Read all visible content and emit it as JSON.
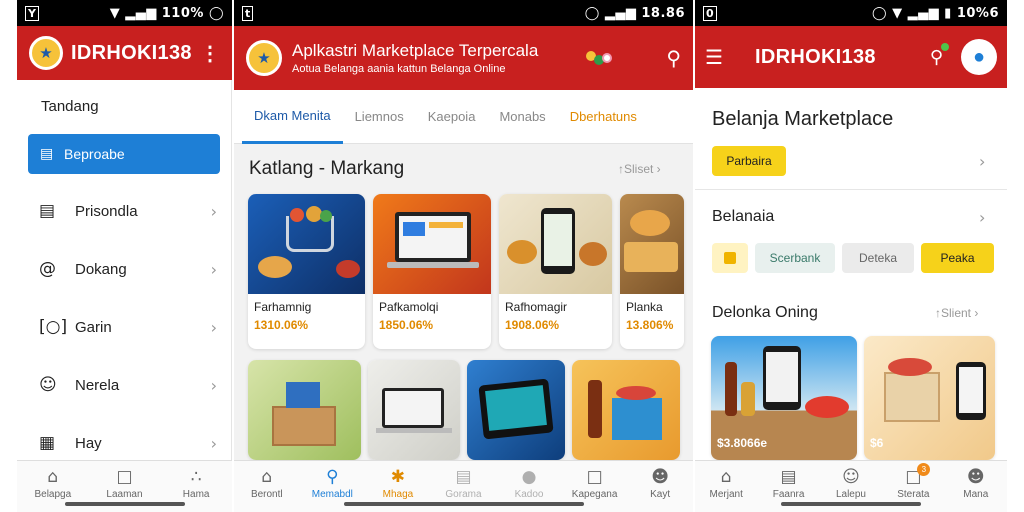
{
  "phone1": {
    "status": {
      "left": "Y",
      "right": "110%"
    },
    "brand": "IDRHOKI138",
    "menu_title": "Tandang",
    "items": [
      {
        "label": "Beproabe",
        "icon": "calendar-icon"
      },
      {
        "label": "Prisondla",
        "icon": "document-icon"
      },
      {
        "label": "Dokang",
        "icon": "at-icon"
      },
      {
        "label": "Garin",
        "icon": "scan-icon"
      },
      {
        "label": "Nerela",
        "icon": "chat-icon"
      },
      {
        "label": "Hay",
        "icon": "grid-icon"
      }
    ],
    "nav": [
      {
        "label": "Belapga",
        "icon": "home-icon"
      },
      {
        "label": "Laaman",
        "icon": "book-icon"
      },
      {
        "label": "Hama",
        "icon": "people-icon"
      }
    ]
  },
  "phone2": {
    "status": {
      "left": "t",
      "right": "18.86"
    },
    "title": "Aplkastri Marketplace Terpercala",
    "subtitle": "Aotua Belanga aania kattun Belanga Online",
    "tabs": [
      "Dkam Menita",
      "Liemnos",
      "Kaepoia",
      "Monabs",
      "Dberhatuns"
    ],
    "section_title": "Katlang - Markang",
    "more": "Sliset",
    "products": [
      {
        "name": "Farhamnig",
        "price": "1310.06%"
      },
      {
        "name": "Pafkamolqi",
        "price": "1850.06%"
      },
      {
        "name": "Rafhomagir",
        "price": "1908.06%"
      },
      {
        "name": "Planka",
        "price": "13.806%"
      }
    ],
    "nav": [
      {
        "label": "Berontl",
        "icon": "home-icon"
      },
      {
        "label": "Memabdl",
        "icon": "search-icon"
      },
      {
        "label": "Mhaga",
        "icon": "puzzle-icon"
      },
      {
        "label": "Gorama",
        "icon": "list-icon"
      },
      {
        "label": "Kadoo",
        "icon": "circle-icon"
      },
      {
        "label": "Kapegana",
        "icon": "book-icon"
      },
      {
        "label": "Kayt",
        "icon": "profile-icon"
      }
    ]
  },
  "phone3": {
    "status": {
      "left": "0",
      "right": "10%6"
    },
    "brand": "IDRHOKI138",
    "heading": "Belanja Marketplace",
    "promo_button": "Parbaira",
    "row_label": "Belanaia",
    "chips": [
      "Scerbank",
      "Deteka",
      "Peaka"
    ],
    "section_title": "Delonka Oning",
    "more": "Slient",
    "product_prices": [
      "$3.8066e",
      "$6"
    ],
    "nav": [
      {
        "label": "Merjant",
        "icon": "home-icon"
      },
      {
        "label": "Faanra",
        "icon": "list-icon"
      },
      {
        "label": "Lalepu",
        "icon": "smile-icon"
      },
      {
        "label": "Sterata",
        "icon": "bag-icon"
      },
      {
        "label": "Mana",
        "icon": "profile-icon"
      }
    ],
    "notification_badge": "3"
  }
}
